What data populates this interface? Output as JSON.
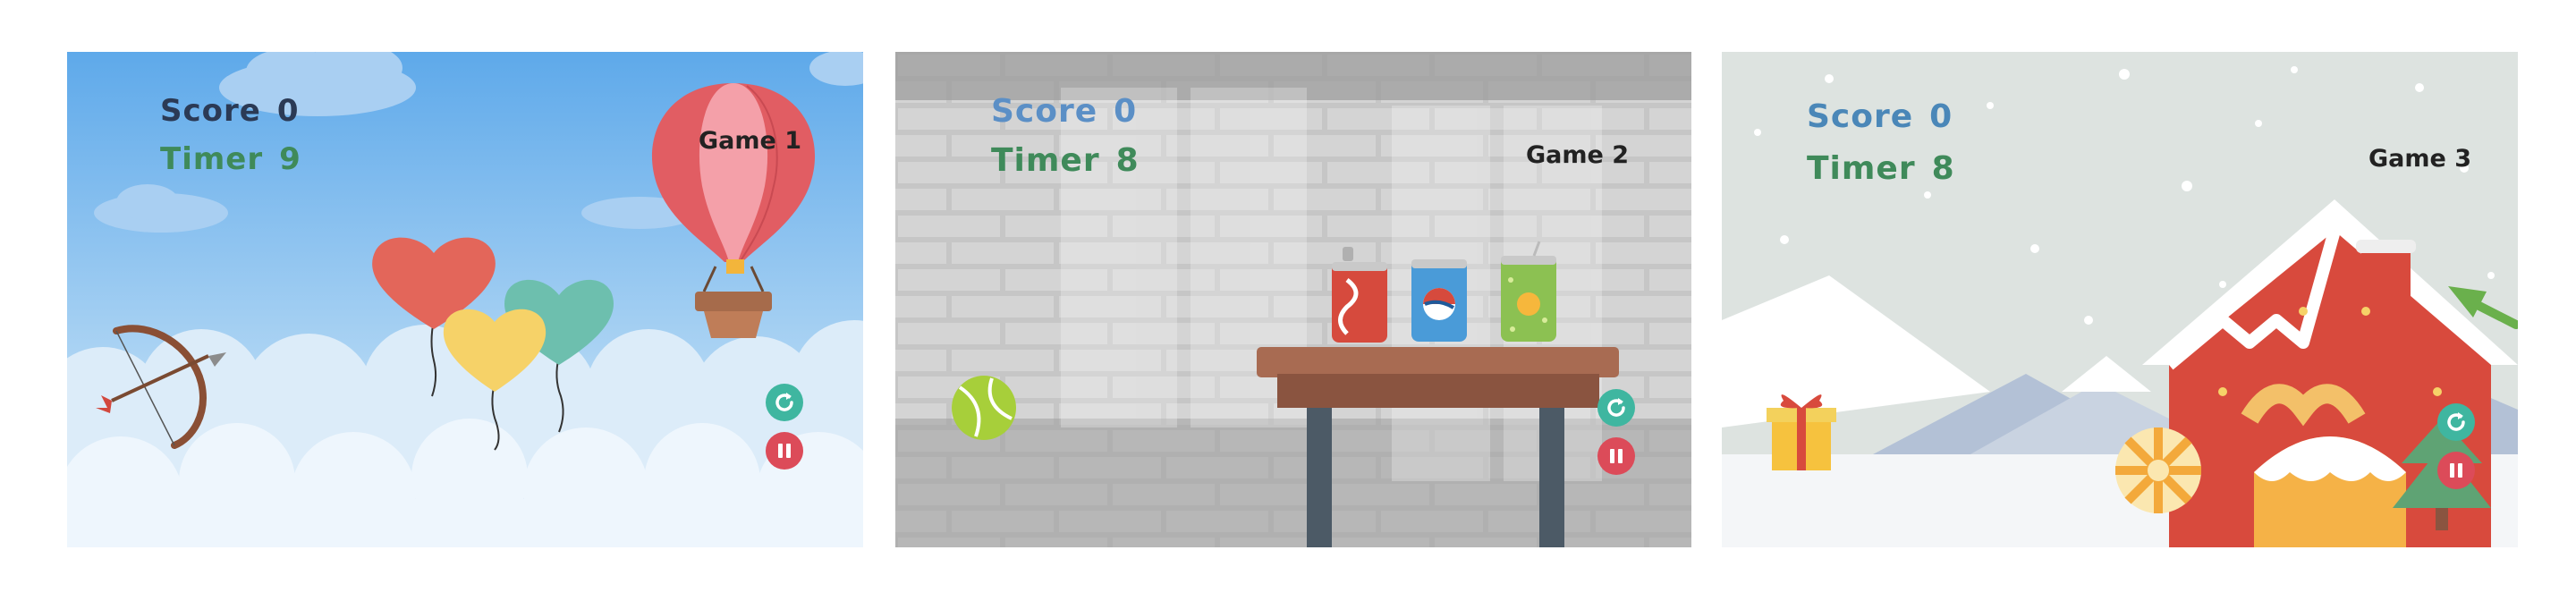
{
  "games": [
    {
      "title": "Game 1",
      "score_label": "Score",
      "score": "0",
      "timer_label": "Timer",
      "timer": "9",
      "theme": "balloons",
      "colors": {
        "sky_top": "#5ea9ea",
        "sky_bottom": "#cfe6f8",
        "score": "#2b3a55",
        "timer": "#3f8a5a"
      },
      "controls": {
        "restart_icon": "refresh-icon",
        "pause_icon": "pause-icon",
        "restart_color": "#3fb6a0",
        "pause_color": "#dc4b59"
      }
    },
    {
      "title": "Game 2",
      "score_label": "Score",
      "score": "0",
      "timer_label": "Timer",
      "timer": "8",
      "theme": "cans",
      "colors": {
        "wall": "#bdbdbd",
        "score": "#5b8fc6",
        "timer": "#3f8a5a"
      },
      "controls": {
        "restart_icon": "refresh-icon",
        "pause_icon": "pause-icon",
        "restart_color": "#3fb6a0",
        "pause_color": "#dc4b59"
      }
    },
    {
      "title": "Game 3",
      "score_label": "Score",
      "score": "0",
      "timer_label": "Timer",
      "timer": "8",
      "theme": "christmas",
      "colors": {
        "sky": "#dde3e0",
        "score": "#4a87b8",
        "timer": "#3f8a5a"
      },
      "controls": {
        "restart_icon": "refresh-icon",
        "pause_icon": "pause-icon",
        "restart_color": "#3fb6a0",
        "pause_color": "#dc4b59"
      }
    }
  ]
}
